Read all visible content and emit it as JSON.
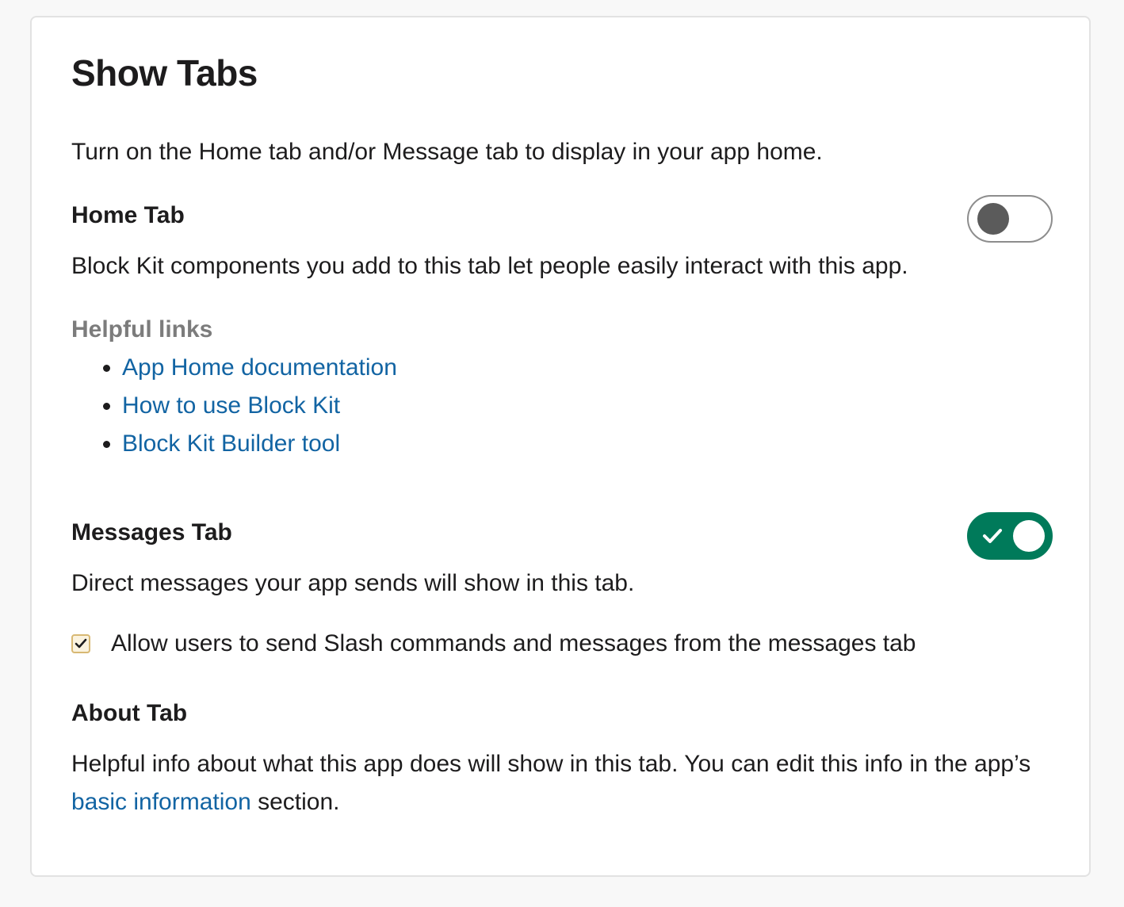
{
  "title": "Show Tabs",
  "intro": "Turn on the Home tab and/or Message tab to display in your app home.",
  "home_tab": {
    "heading": "Home Tab",
    "toggle_on": false,
    "description": "Block Kit components you add to this tab let people easily interact with this app.",
    "helpful_links_title": "Helpful links",
    "links": [
      {
        "label": "App Home documentation"
      },
      {
        "label": "How to use Block Kit"
      },
      {
        "label": "Block Kit Builder tool"
      }
    ]
  },
  "messages_tab": {
    "heading": "Messages Tab",
    "toggle_on": true,
    "description": "Direct messages your app sends will show in this tab.",
    "checkbox_checked": true,
    "checkbox_label": "Allow users to send Slash commands and messages from the messages tab"
  },
  "about_tab": {
    "heading": "About Tab",
    "description_prefix": "Helpful info about what this app does will show in this tab. You can edit this info in the app’s ",
    "link_label": "basic information",
    "description_suffix": " section."
  },
  "colors": {
    "accent_green": "#007a5a",
    "link_blue": "#1264a3",
    "muted_gray": "#7c7c7c"
  },
  "icons": {
    "toggle_check": "check-icon",
    "checkbox_check": "checkmark-icon"
  }
}
